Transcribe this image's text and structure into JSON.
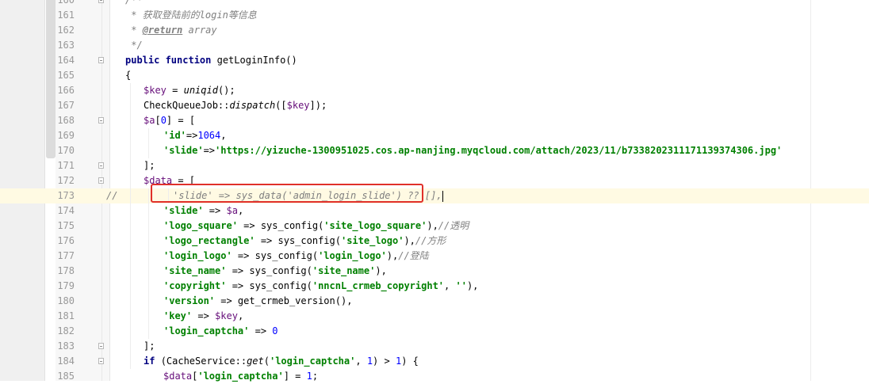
{
  "editor": {
    "line_numbers": [
      "160",
      "161",
      "162",
      "163",
      "164",
      "165",
      "166",
      "167",
      "168",
      "169",
      "170",
      "171",
      "172",
      "173",
      "174",
      "175",
      "176",
      "177",
      "178",
      "179",
      "180",
      "181",
      "182",
      "183",
      "184",
      "185"
    ],
    "current_line_index": 13,
    "line_prefix_173": "//",
    "lines": [
      [
        {
          "t": "/**",
          "c": "c"
        }
      ],
      [
        {
          "t": " * 获取登陆前的login等信息",
          "c": "c"
        }
      ],
      [
        {
          "t": " * ",
          "c": "c"
        },
        {
          "t": "@return",
          "c": "ct"
        },
        {
          "t": " array",
          "c": "c"
        }
      ],
      [
        {
          "t": " */",
          "c": "c"
        }
      ],
      [
        {
          "t": "public ",
          "c": "k"
        },
        {
          "t": "function ",
          "c": "k"
        },
        {
          "t": "getLoginInfo()",
          "c": "t"
        }
      ],
      [
        {
          "t": "{",
          "c": "t"
        }
      ],
      [
        {
          "t": "$key",
          "c": "v"
        },
        {
          "t": " = ",
          "c": "t"
        },
        {
          "t": "uniqid",
          "c": "f"
        },
        {
          "t": "();",
          "c": "t"
        }
      ],
      [
        {
          "t": "CheckQueueJob::",
          "c": "t"
        },
        {
          "t": "dispatch",
          "c": "f"
        },
        {
          "t": "([",
          "c": "t"
        },
        {
          "t": "$key",
          "c": "v"
        },
        {
          "t": "]);",
          "c": "t"
        }
      ],
      [
        {
          "t": "$a",
          "c": "v"
        },
        {
          "t": "[",
          "c": "t"
        },
        {
          "t": "0",
          "c": "n"
        },
        {
          "t": "] = [",
          "c": "t"
        }
      ],
      [
        {
          "t": "'id'",
          "c": "s"
        },
        {
          "t": "=>",
          "c": "t"
        },
        {
          "t": "1064",
          "c": "n"
        },
        {
          "t": ",",
          "c": "t"
        }
      ],
      [
        {
          "t": "'slide'",
          "c": "s"
        },
        {
          "t": "=>",
          "c": "t"
        },
        {
          "t": "'https://yizuche-1300951025.cos.ap-nanjing.myqcloud.com/attach/2023/11/b7338202311171139374306.jpg'",
          "c": "s"
        }
      ],
      [
        {
          "t": "];",
          "c": "t"
        }
      ],
      [
        {
          "t": "$data",
          "c": "v"
        },
        {
          "t": " = [",
          "c": "t"
        }
      ],
      [
        {
          "t": "'slide' => sys_data('admin_login_slide') ?? [],",
          "c": "cm"
        }
      ],
      [
        {
          "t": "'slide'",
          "c": "s"
        },
        {
          "t": " => ",
          "c": "t"
        },
        {
          "t": "$a",
          "c": "v"
        },
        {
          "t": ",",
          "c": "t"
        }
      ],
      [
        {
          "t": "'logo_square'",
          "c": "s"
        },
        {
          "t": " => sys_config(",
          "c": "t"
        },
        {
          "t": "'site_logo_square'",
          "c": "s"
        },
        {
          "t": "),",
          "c": "t"
        },
        {
          "t": "//透明",
          "c": "c"
        }
      ],
      [
        {
          "t": "'logo_rectangle'",
          "c": "s"
        },
        {
          "t": " => sys_config(",
          "c": "t"
        },
        {
          "t": "'site_logo'",
          "c": "s"
        },
        {
          "t": "),",
          "c": "t"
        },
        {
          "t": "//方形",
          "c": "c"
        }
      ],
      [
        {
          "t": "'login_logo'",
          "c": "s"
        },
        {
          "t": " => sys_config(",
          "c": "t"
        },
        {
          "t": "'login_logo'",
          "c": "s"
        },
        {
          "t": "),",
          "c": "t"
        },
        {
          "t": "//登陆",
          "c": "c"
        }
      ],
      [
        {
          "t": "'site_name'",
          "c": "s"
        },
        {
          "t": " => sys_config(",
          "c": "t"
        },
        {
          "t": "'site_name'",
          "c": "s"
        },
        {
          "t": "),",
          "c": "t"
        }
      ],
      [
        {
          "t": "'copyright'",
          "c": "s"
        },
        {
          "t": " => sys_config(",
          "c": "t"
        },
        {
          "t": "'nncnL_crmeb_copyright'",
          "c": "s"
        },
        {
          "t": ", ",
          "c": "t"
        },
        {
          "t": "''",
          "c": "s"
        },
        {
          "t": "),",
          "c": "t"
        }
      ],
      [
        {
          "t": "'version'",
          "c": "s"
        },
        {
          "t": " => get_crmeb_version(),",
          "c": "t"
        }
      ],
      [
        {
          "t": "'key'",
          "c": "s"
        },
        {
          "t": " => ",
          "c": "t"
        },
        {
          "t": "$key",
          "c": "v"
        },
        {
          "t": ",",
          "c": "t"
        }
      ],
      [
        {
          "t": "'login_captcha'",
          "c": "s"
        },
        {
          "t": " => ",
          "c": "t"
        },
        {
          "t": "0",
          "c": "n"
        }
      ],
      [
        {
          "t": "];",
          "c": "t"
        }
      ],
      [
        {
          "t": "if ",
          "c": "k"
        },
        {
          "t": "(CacheService::",
          "c": "t"
        },
        {
          "t": "get",
          "c": "f"
        },
        {
          "t": "(",
          "c": "t"
        },
        {
          "t": "'login_captcha'",
          "c": "s"
        },
        {
          "t": ", ",
          "c": "t"
        },
        {
          "t": "1",
          "c": "n"
        },
        {
          "t": ") > ",
          "c": "t"
        },
        {
          "t": "1",
          "c": "n"
        },
        {
          "t": ") {",
          "c": "t"
        }
      ],
      [
        {
          "t": "$data",
          "c": "v"
        },
        {
          "t": "[",
          "c": "t"
        },
        {
          "t": "'login_captcha'",
          "c": "s"
        },
        {
          "t": "] = ",
          "c": "t"
        },
        {
          "t": "1",
          "c": "n"
        },
        {
          "t": ";",
          "c": "t"
        }
      ]
    ]
  }
}
